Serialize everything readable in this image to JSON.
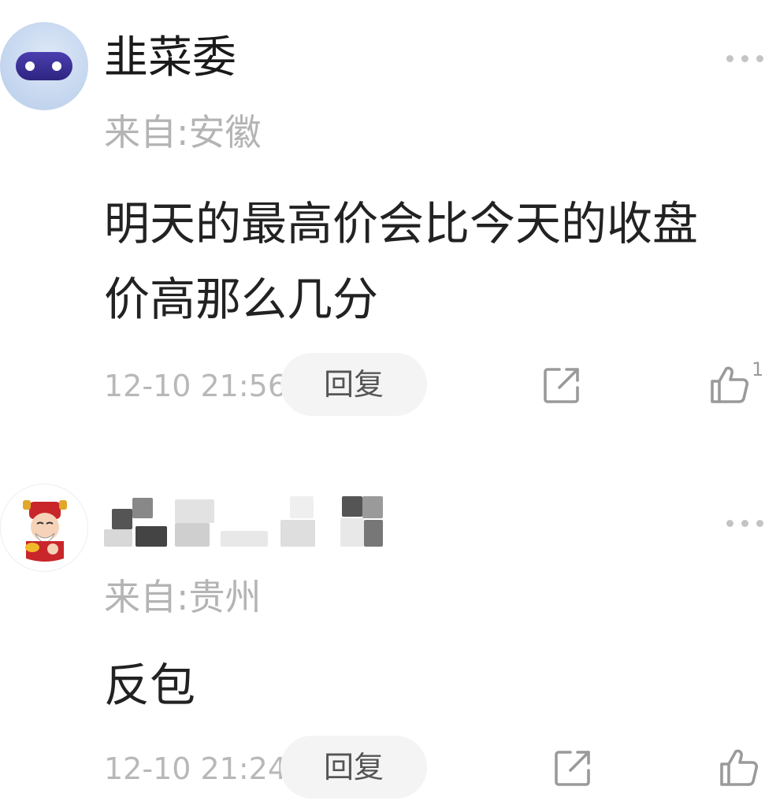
{
  "comments": [
    {
      "username": "韭菜委",
      "location": "来自:安徽",
      "text": "明天的最高价会比今天的收盘价高那么几分",
      "timestamp": "12-10 21:56",
      "reply_label": "回复",
      "like_count": "1",
      "avatar_icon": "robot-avatar"
    },
    {
      "username_blurred": true,
      "location": "来自:贵州",
      "text": "反包",
      "timestamp": "12-10 21:24",
      "reply_label": "回复",
      "like_count": "",
      "avatar_icon": "fortune-god-avatar"
    }
  ],
  "icons": {
    "more": "more-dots-icon",
    "share": "share-icon",
    "like": "thumbs-up-icon"
  },
  "colors": {
    "secondary_text": "#b4b4b4",
    "reply_bg": "#f4f4f4",
    "icon_gray": "#9a9a9a"
  }
}
